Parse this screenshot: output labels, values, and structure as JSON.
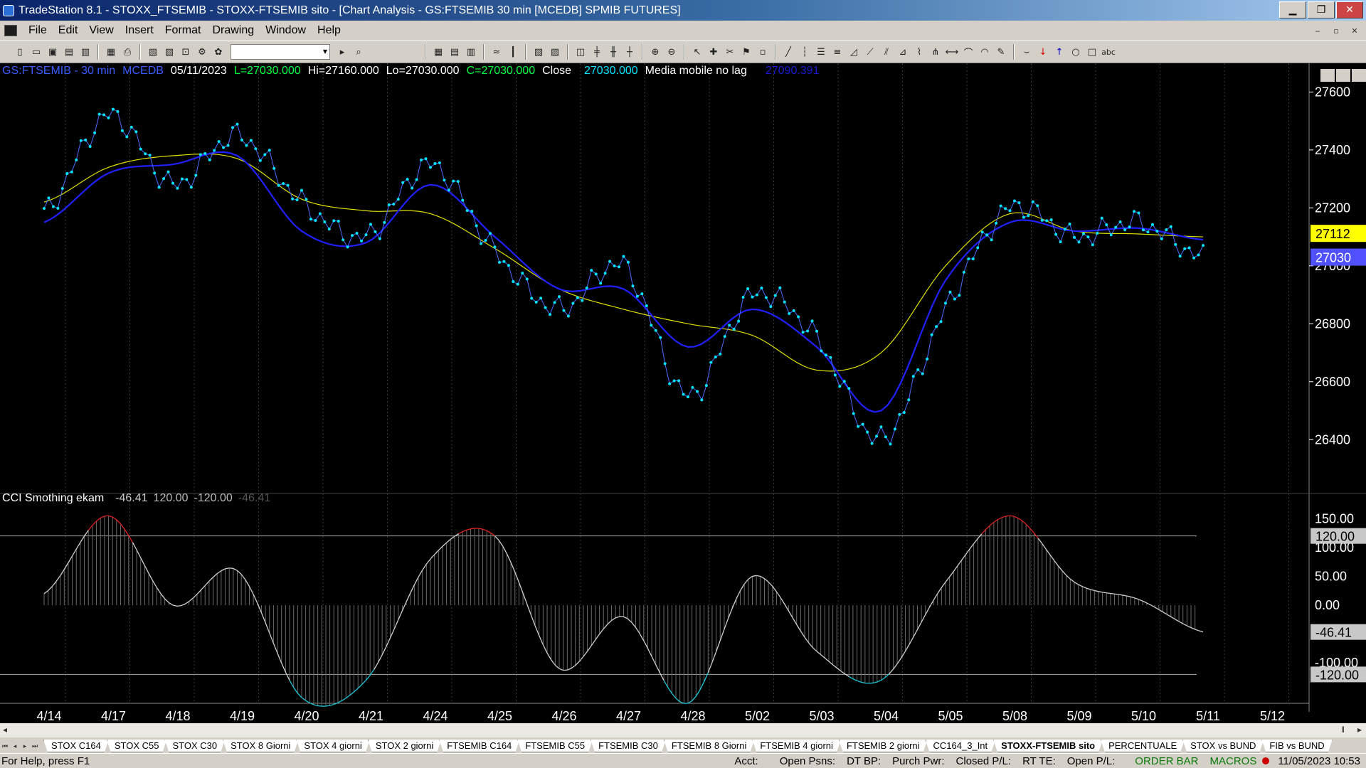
{
  "window": {
    "title": "TradeStation 8.1 - STOXX_FTSEMIB - STOXX-FTSEMIB sito - [Chart Analysis - GS:FTSEMIB  30 min  [MCEDB] SPMIB FUTURES]",
    "min": "▁",
    "max": "❐",
    "close": "✕"
  },
  "menu": [
    "File",
    "Edit",
    "View",
    "Insert",
    "Format",
    "Drawing",
    "Window",
    "Help"
  ],
  "mdi": {
    "min": "‒",
    "restore": "▫",
    "close": "✕"
  },
  "header": {
    "symbol": "GS:FTSEMIB - 30 min",
    "exchange": "MCEDB",
    "date": "05/11/2023",
    "last": "L=27030.000",
    "hi": "Hi=27160.000",
    "lo": "Lo=27030.000",
    "close_val": "C=27030.000",
    "close_label": "Close",
    "close_price": "27030.000",
    "indicator": "Media mobile no lag",
    "indicator_value": "27090.391"
  },
  "subheader": {
    "name": "CCI Smothing ekam",
    "v1": "-46.41",
    "v2": "120.00",
    "v3": "-120.00",
    "v4": "-46.41"
  },
  "price_axis": {
    "ticks": [
      {
        "label": "27600",
        "v": 27600
      },
      {
        "label": "27400",
        "v": 27400
      },
      {
        "label": "27200",
        "v": 27200
      },
      {
        "label": "27000",
        "v": 27000
      },
      {
        "label": "26800",
        "v": 26800
      },
      {
        "label": "26600",
        "v": 26600
      },
      {
        "label": "26400",
        "v": 26400
      }
    ],
    "markers": [
      {
        "label": "27112",
        "value": 27112,
        "bg": "#ffff00",
        "fg": "#000000"
      },
      {
        "label": "27030",
        "value": 27030,
        "bg": "#5050ff",
        "fg": "#ffffff"
      }
    ]
  },
  "cci_axis": {
    "ticks": [
      {
        "label": "150.00",
        "v": 150
      },
      {
        "label": "100.00",
        "v": 100
      },
      {
        "label": "50.00",
        "v": 50
      },
      {
        "label": "0.00",
        "v": 0
      },
      {
        "label": "-100.00",
        "v": -100
      }
    ],
    "markers": [
      {
        "label": "120.00",
        "value": 120
      },
      {
        "label": "-46.41",
        "value": -46.41
      },
      {
        "label": "-120.00",
        "value": -120
      }
    ]
  },
  "date_axis": [
    "4/14",
    "4/17",
    "4/18",
    "4/19",
    "4/20",
    "4/21",
    "4/24",
    "4/25",
    "4/26",
    "4/27",
    "4/28",
    "5/02",
    "5/03",
    "5/04",
    "5/05",
    "5/08",
    "5/09",
    "5/10",
    "5/11",
    "5/12"
  ],
  "chart_data": [
    {
      "type": "line",
      "title": "GS:FTSEMIB - 30 min",
      "x": [
        "4/14",
        "4/17",
        "4/18",
        "4/19",
        "4/20",
        "4/21",
        "4/24",
        "4/25",
        "4/26",
        "4/27",
        "4/28",
        "5/02",
        "5/03",
        "5/04",
        "5/05",
        "5/08",
        "5/09",
        "5/10",
        "5/11"
      ],
      "series": [
        {
          "name": "Close",
          "color": "#00e5ff",
          "values": [
            27180,
            27520,
            27280,
            27450,
            27220,
            27100,
            27350,
            27050,
            26850,
            27000,
            26550,
            26900,
            26750,
            26400,
            26850,
            27200,
            27100,
            27150,
            27030
          ]
        },
        {
          "name": "Media mobile no lag",
          "color": "#2020ff",
          "values": [
            27150,
            27320,
            27350,
            27380,
            27120,
            27080,
            27280,
            27100,
            26920,
            26920,
            26720,
            26850,
            26720,
            26500,
            26950,
            27150,
            27120,
            27130,
            27090
          ]
        },
        {
          "color": "#e0e000",
          "values": [
            27220,
            27340,
            27380,
            27370,
            27230,
            27190,
            27180,
            27060,
            26920,
            26850,
            26800,
            26760,
            26640,
            26700,
            27000,
            27180,
            27120,
            27110,
            27100
          ]
        }
      ],
      "ylim": [
        26300,
        27650
      ]
    },
    {
      "type": "line",
      "title": "CCI Smothing ekam",
      "x": [
        "4/14",
        "4/17",
        "4/18",
        "4/19",
        "4/20",
        "4/21",
        "4/24",
        "4/25",
        "4/26",
        "4/27",
        "4/28",
        "5/02",
        "5/03",
        "5/04",
        "5/05",
        "5/08",
        "5/09",
        "5/10",
        "5/11"
      ],
      "series": [
        {
          "name": "CCI Smothing ekam",
          "values": [
            20,
            155,
            0,
            60,
            -160,
            -130,
            80,
            120,
            -110,
            -20,
            -170,
            50,
            -80,
            -130,
            40,
            155,
            40,
            10,
            -46.41
          ]
        }
      ],
      "levels": [
        120,
        -120
      ],
      "ylim": [
        -170,
        175
      ]
    }
  ],
  "tabs": [
    "STOX C164",
    "STOX C55",
    "STOX  C30",
    "STOX  8 Giorni",
    "STOX 4 giorni",
    "STOX  2 giorni",
    "FTSEMIB C164",
    "FTSEMIB C55",
    "FTSEMIB C30",
    "FTSEMIB  8 Giorni",
    "FTSEMIB  4 giorni",
    "FTSEMIB  2 giorni",
    "CC164_3_Int",
    "STOXX-FTSEMIB sito",
    "PERCENTUALE",
    "STOX vs BUND",
    "FIB vs BUND"
  ],
  "active_tab": "STOXX-FTSEMIB sito",
  "status": {
    "help": "For Help, press F1",
    "acct": "Acct:",
    "open_psns": "Open Psns:",
    "dt_bp": "DT BP:",
    "purch": "Purch Pwr:",
    "closed": "Closed P/L:",
    "rt": "RT TE:",
    "open_pl": "Open P/L:",
    "order_bar": "ORDER BAR",
    "macros": "MACROS",
    "datetime": "11/05/2023 10:53"
  }
}
